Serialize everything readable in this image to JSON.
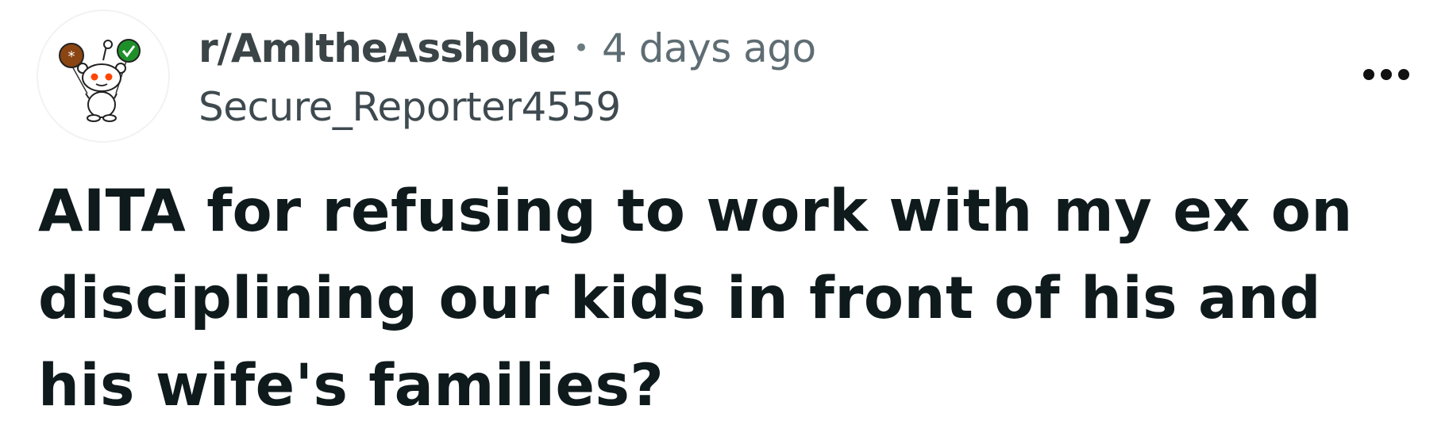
{
  "post": {
    "subreddit": "r/AmItheAsshole",
    "separator": "•",
    "age": "4 days ago",
    "author": "Secure_Reporter4559",
    "title": "AITA for refusing to work with my ex on disciplining our kids in front of his and his wife's families?"
  },
  "icons": {
    "avatar": "snoo-avatar-icon",
    "more": "more-options-icon"
  },
  "colors": {
    "title": "#0f1a1c",
    "meta": "#5e6d73",
    "balloon_brown": "#8b4513",
    "balloon_green": "#1f8f2a",
    "snoo_orange": "#ff4500"
  }
}
